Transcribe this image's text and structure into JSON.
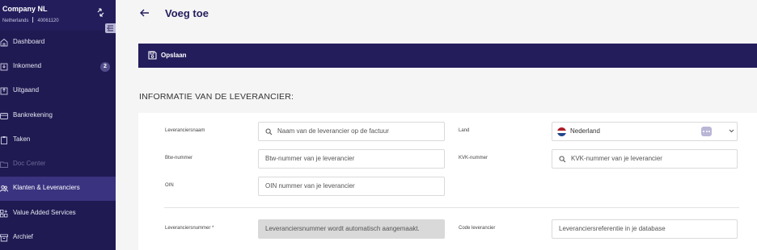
{
  "sidebar": {
    "company_name": "Company NL",
    "company_country": "Netherlands",
    "company_id": "40061120",
    "items": [
      {
        "label": "Dashboard",
        "icon": "home-icon"
      },
      {
        "label": "Inkomend",
        "icon": "inbox-icon",
        "badge": "2"
      },
      {
        "label": "Uitgaand",
        "icon": "outbox-icon"
      },
      {
        "label": "Bankrekening",
        "icon": "bank-card-icon"
      },
      {
        "label": "Taken",
        "icon": "clipboard-icon"
      },
      {
        "label": "Doc Center",
        "icon": "folder-icon",
        "disabled": true
      },
      {
        "label": "Klanten & Leveranciers",
        "icon": "users-icon",
        "active": true
      },
      {
        "label": "Value Added Services",
        "icon": "grid-plus-icon"
      },
      {
        "label": "Archief",
        "icon": "archive-icon"
      }
    ]
  },
  "header": {
    "title": "Voeg toe"
  },
  "toolbar": {
    "save_label": "Opslaan"
  },
  "section": {
    "title": "INFORMATIE VAN DE LEVERANCIER:"
  },
  "form": {
    "supplier_name": {
      "label": "Leveranciersnaam",
      "placeholder": "Naam van de leverancier op de factuur"
    },
    "vat_number": {
      "label": "Btw-nummer",
      "placeholder": "Btw-nummer van je leverancier"
    },
    "oin": {
      "label": "OIN",
      "placeholder": "OIN nummer van je leverancier"
    },
    "country": {
      "label": "Land",
      "value": "Nederland"
    },
    "kvk_number": {
      "label": "KVK-nummer",
      "placeholder": "KVK-nummer van je leverancier"
    },
    "supplier_number": {
      "label": "Leveranciersnummer *",
      "placeholder": "Leveranciersnummer wordt automatisch aangemaakt."
    },
    "supplier_code": {
      "label": "Code leverancier",
      "placeholder": "Leveranciersreferentie in je database"
    }
  },
  "colors": {
    "sidebar_bg": "#1f1a52",
    "primary": "#231d5c",
    "active_item": "#3a3380",
    "accent_light": "#b9b6d6"
  }
}
